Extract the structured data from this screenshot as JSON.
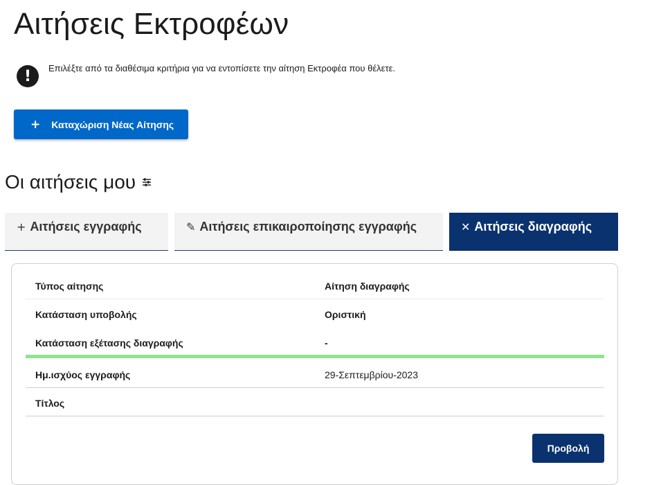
{
  "header": {
    "title": "Αιτήσεις Εκτροφέων",
    "info_text": "Επιλέξτε από τα διαθέσιμα κριτήρια για να εντοπίσετε την αίτηση Εκτροφέα που θέλετε.",
    "info_icon": "exclamation-icon"
  },
  "actions": {
    "new_application_label": "Καταχώριση Νέας Αίτησης",
    "new_application_icon": "+"
  },
  "section": {
    "title": "Οι αιτήσεις μου",
    "filter_icon": "sliders-icon"
  },
  "tabs": [
    {
      "icon": "+",
      "label": "Αιτήσεις εγγραφής",
      "active": false
    },
    {
      "icon": "✎",
      "label": "Αιτήσεις επικαιροποίησης εγγραφής",
      "active": false
    },
    {
      "icon": "✕",
      "label": "Αιτήσεις διαγραφής",
      "active": true
    }
  ],
  "card": {
    "rows": [
      {
        "label": "Τύπος αίτησης",
        "value": "Αίτηση διαγραφής"
      },
      {
        "label": "Κατάσταση υποβολής",
        "value": "Οριστική"
      },
      {
        "label": "Κατάσταση εξέτασης διαγραφής",
        "value": "-"
      },
      {
        "label": "Ημ.ισχύος εγγραφής",
        "value": "29-Σεπτεμβρίου-2023"
      },
      {
        "label": "Τίτλος",
        "value": ""
      }
    ],
    "view_label": "Προβολή"
  },
  "colors": {
    "primary": "#0068c8",
    "navy": "#0a326e",
    "status_bar": "#8fe38f"
  }
}
